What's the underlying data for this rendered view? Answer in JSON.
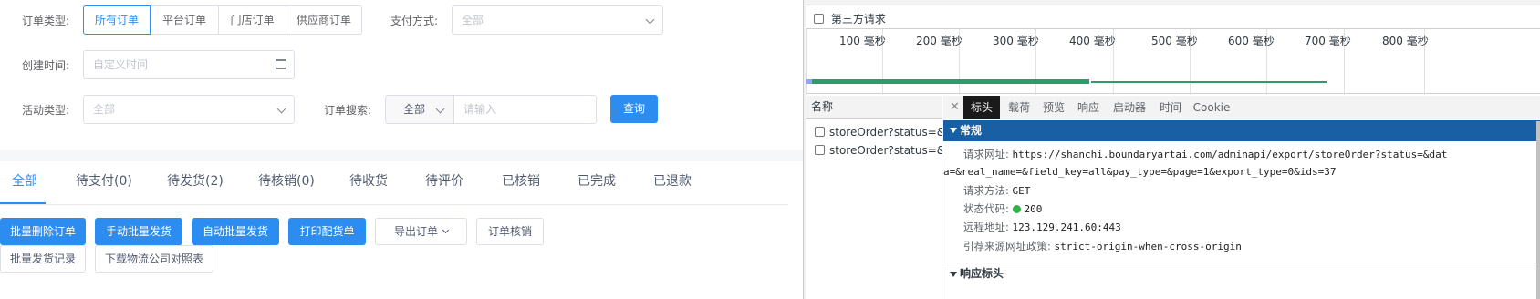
{
  "filters": {
    "order_type_label": "订单类型:",
    "order_type_options": [
      "所有订单",
      "平台订单",
      "门店订单",
      "供应商订单"
    ],
    "order_type_selected": "所有订单",
    "pay_method_label": "支付方式:",
    "pay_method_placeholder": "全部",
    "created_time_label": "创建时间:",
    "created_time_placeholder": "自定义时间",
    "activity_type_label": "活动类型:",
    "activity_type_placeholder": "全部",
    "search_label": "订单搜索:",
    "search_scope": "全部",
    "search_placeholder": "请输入",
    "query_button": "查询"
  },
  "tabs": [
    "全部",
    "待支付(0)",
    "待发货(2)",
    "待核销(0)",
    "待收货",
    "待评价",
    "已核销",
    "已完成",
    "已退款"
  ],
  "active_tab": "全部",
  "actions": {
    "primary": [
      "批量删除订单",
      "手动批量发货",
      "自动批量发货",
      "打印配货单"
    ],
    "export": "导出订单",
    "verify": "订单核销",
    "row2": [
      "批量发货记录",
      "下载物流公司对照表"
    ]
  },
  "devtools": {
    "third_party_label": "第三方请求",
    "timeline_ticks": [
      "100 毫秒",
      "200 毫秒",
      "300 毫秒",
      "400 毫秒",
      "500 毫秒",
      "600 毫秒",
      "700 毫秒",
      "800 毫秒"
    ],
    "name_header": "名称",
    "requests": [
      "storeOrder?status=&d...",
      "storeOrder?status=&d..."
    ],
    "detail_tabs": [
      "标头",
      "载荷",
      "预览",
      "响应",
      "启动器",
      "时间",
      "Cookie"
    ],
    "active_detail_tab": "标头",
    "general_section": "常规",
    "request_url_key": "请求网址:",
    "request_url_line1": "https://shanchi.boundaryartai.com/adminapi/export/storeOrder?status=&dat",
    "request_url_line2": "a=&real_name=&field_key=all&pay_type=&page=1&export_type=0&ids=37",
    "method_key": "请求方法:",
    "method_value": "GET",
    "status_key": "状态代码:",
    "status_value": "200",
    "remote_key": "远程地址:",
    "remote_value": "123.129.241.60:443",
    "referrer_key": "引荐来源网址政策:",
    "referrer_value": "strict-origin-when-cross-origin",
    "response_headers_section": "响应标头",
    "colors": {
      "accent": "#2d8cf0",
      "section_bar": "#195fa4",
      "status_ok": "#31b24a",
      "timeline_bar": "#2d9c6a"
    }
  }
}
